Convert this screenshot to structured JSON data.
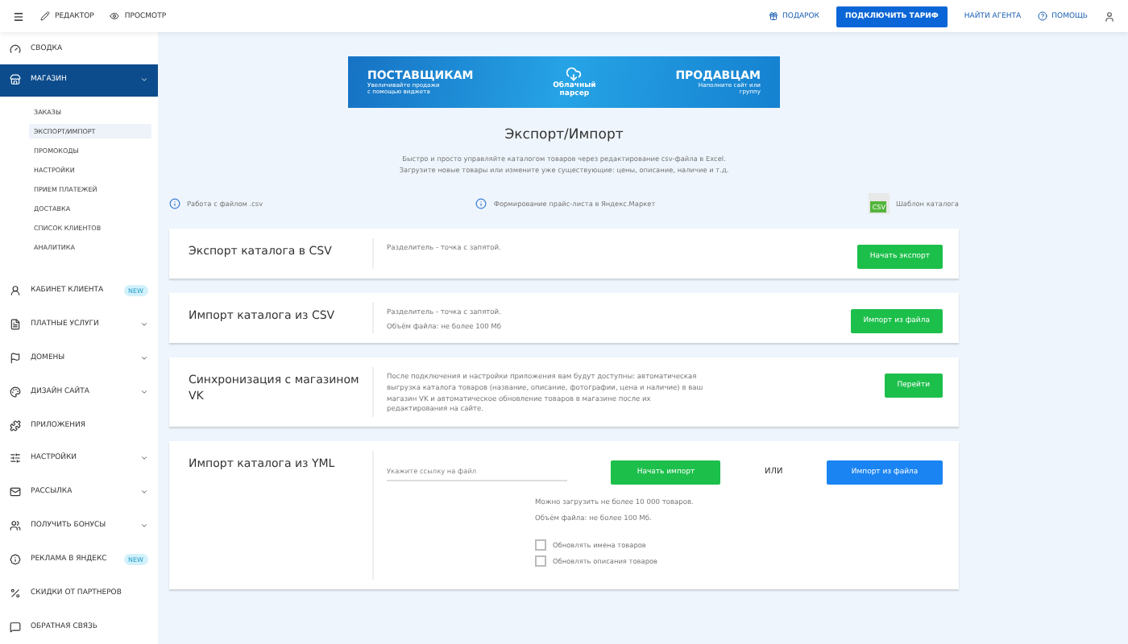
{
  "topbar": {
    "left": [
      {
        "label": "РЕДАКТОР",
        "kind": "pencil"
      },
      {
        "label": "ПРОСМОТР",
        "kind": "eye"
      }
    ],
    "right": [
      {
        "label": "ПОДАРОК",
        "kind": "gift"
      },
      {
        "label": "ПОДКЛЮЧИТЬ ТАРИФ",
        "kind": "primary"
      },
      {
        "label": "НАЙТИ АГЕНТА",
        "kind": "plain"
      },
      {
        "label": "ПОМОЩЬ",
        "kind": "help"
      }
    ]
  },
  "sidebar": {
    "items": [
      {
        "label": "СВОДКА",
        "kind": "link",
        "selected": false
      },
      {
        "label": "МАГАЗИН",
        "kind": "dropdown",
        "selected": true,
        "children": [
          {
            "label": "ЗАКАЗЫ",
            "selected": false
          },
          {
            "label": "ЭКСПОРТ/ИМПОРТ",
            "selected": true
          },
          {
            "label": "ПРОМОКОДЫ",
            "selected": false
          },
          {
            "label": "НАСТРОЙКИ",
            "selected": false
          },
          {
            "label": "ПРИЕМ ПЛАТЕЖЕЙ",
            "selected": false
          },
          {
            "label": "ДОСТАВКА",
            "selected": false
          },
          {
            "label": "СПИСОК КЛИЕНТОВ",
            "selected": false
          },
          {
            "label": "АНАЛИТИКА",
            "selected": false
          }
        ]
      },
      {
        "label": "КАБИНЕТ КЛИЕНТА",
        "kind": "link",
        "selected": false,
        "badge": "NEW"
      },
      {
        "label": "ПЛАТНЫЕ УСЛУГИ",
        "kind": "dropdown",
        "selected": false
      },
      {
        "label": "ДОМЕНЫ",
        "kind": "dropdown",
        "selected": false
      },
      {
        "label": "ДИЗАЙН САЙТА",
        "kind": "dropdown",
        "selected": false
      },
      {
        "label": "ПРИЛОЖЕНИЯ",
        "kind": "link",
        "selected": false
      },
      {
        "label": "НАСТРОЙКИ",
        "kind": "dropdown",
        "selected": false
      },
      {
        "label": "РАССЫЛКА",
        "kind": "dropdown",
        "selected": false
      },
      {
        "label": "ПОЛУЧИТЬ БОНУСЫ",
        "kind": "dropdown",
        "selected": false
      },
      {
        "label": "РЕКЛАМА В ЯНДЕКС",
        "kind": "link",
        "selected": false,
        "badge": "NEW"
      },
      {
        "label": "СКИДКИ ОТ ПАРТНЕРОВ",
        "kind": "link",
        "selected": false
      },
      {
        "label": "ОБРАТНАЯ СВЯЗЬ",
        "kind": "link",
        "selected": false
      }
    ]
  },
  "banner": {
    "left_title": "ПОСТАВЩИКАМ",
    "left_text": "Увеличивайте продажи с помощью виджета",
    "center": "Облачный парсер",
    "right_title": "ПРОДАВЦАМ",
    "right_text": "Наполните сайт или группу"
  },
  "page": {
    "title": "Экспорт/Импорт",
    "description": [
      "Быстро и просто управляйте каталогом товаров через редактирование csv-файла в Excel.",
      "Загрузите новые товары или измените уже существующие: цены, описание, наличие и т.д."
    ],
    "links": [
      {
        "label": "Работа с файлом .csv",
        "kind": "info"
      },
      {
        "label": "Формирование прайс-листа в Яндекс.Маркет",
        "kind": "info"
      },
      {
        "label": "Шаблон каталога",
        "kind": "file",
        "file_tag": "CSV"
      }
    ]
  },
  "cards": [
    {
      "kind": "simple",
      "title": "Экспорт каталога в CSV",
      "text": [
        "Разделитель - точка с запятой."
      ],
      "button": "Начать экспорт"
    },
    {
      "kind": "simple",
      "title": "Импорт каталога из CSV",
      "text": [
        "Разделитель - точка с запятой.",
        "Объём файла: не более 100 Мб"
      ],
      "button": "Импорт из файла"
    },
    {
      "kind": "simple",
      "title": "Синхронизация с магазином VK",
      "text": [
        "После подключения и настройки приложения вам будут доступны: автоматическая выгрузка каталога товаров (название, описание, фотографии, цена и наличие) в ваш магазин VK и автоматическое обновление товаров в магазине после их редактирования на сайте."
      ],
      "button": "Перейти"
    },
    {
      "kind": "yml",
      "title": "Импорт каталога из YML",
      "field": {
        "placeholder": "Укажите ссылку на файл"
      },
      "button": "Начать импорт",
      "or": "ИЛИ",
      "file_button": "Импорт из файла",
      "notes": [
        "Можно загрузить не более 10 000 товаров.",
        "Объём файла: не более 100 Мб."
      ],
      "checkboxes": [
        {
          "label": "Обновлять имена товаров",
          "checked": false
        },
        {
          "label": "Обновлять описания товаров",
          "checked": false
        }
      ]
    }
  ]
}
